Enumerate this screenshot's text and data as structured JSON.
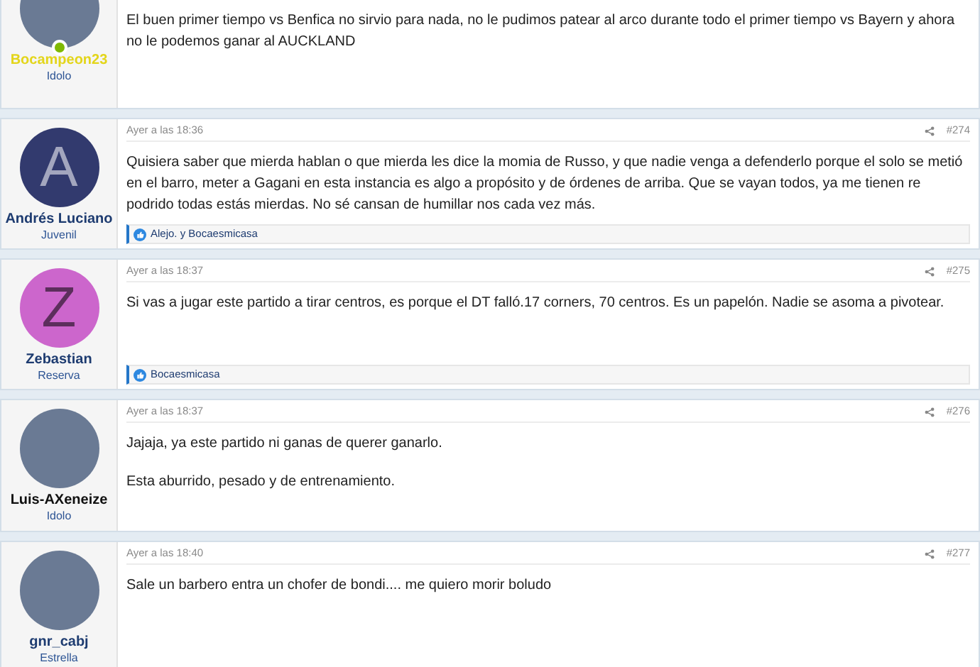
{
  "posts": [
    {
      "author": {
        "name": "Bocampeon23",
        "color": "#e3d51a",
        "rank": "Idolo",
        "avatar": {
          "kind": "photo"
        },
        "online": true
      },
      "paragraphs": [
        "El buen primer tiempo vs Benfica no sirvio para nada, no le pudimos patear al arco durante todo el primer tiempo vs Bayern y ahora no le podemos ganar al AUCKLAND"
      ]
    },
    {
      "author": {
        "name": "Andrés Luciano",
        "color": "#1d3b70",
        "rank": "Juvenil",
        "avatar": {
          "kind": "letter",
          "letter": "A",
          "color": "#323a6e"
        },
        "online": false
      },
      "date": "Ayer a las 18:36",
      "number": "#274",
      "paragraphs": [
        "Quisiera saber que mierda hablan o que mierda les dice la momia de Russo, y que nadie venga a defenderlo porque el solo se metió en el barro, meter a Gagani en esta instancia es algo a propósito y de órdenes de arriba. Que se vayan todos, ya me tienen re podrido todas estás mierdas. No sé cansan de humillar nos cada vez más."
      ],
      "reactions": "Alejo. y Bocaesmicasa"
    },
    {
      "author": {
        "name": "Zebastian",
        "color": "#1d3b70",
        "rank": "Reserva",
        "avatar": {
          "kind": "letter",
          "letter": "Z",
          "color": "#cc66cc"
        },
        "online": false
      },
      "date": "Ayer a las 18:37",
      "number": "#275",
      "paragraphs": [
        "Si vas a jugar este partido a tirar centros, es porque el DT falló.17 corners, 70 centros. Es un papelón. Nadie se asoma a pivotear."
      ],
      "reactions": "Bocaesmicasa"
    },
    {
      "author": {
        "name": "Luis-AXeneize",
        "color": "#111111",
        "rank": "Idolo",
        "avatar": {
          "kind": "photo"
        },
        "online": false
      },
      "date": "Ayer a las 18:37",
      "number": "#276",
      "paragraphs": [
        "Jajaja, ya este partido ni ganas de querer ganarlo.",
        "Esta aburrido, pesado y de entrenamiento."
      ]
    },
    {
      "author": {
        "name": "gnr_cabj",
        "color": "#1d3b70",
        "rank": "Estrella",
        "avatar": {
          "kind": "photo"
        },
        "online": false
      },
      "date": "Ayer a las 18:40",
      "number": "#277",
      "paragraphs": [
        "Sale un barbero entra un chofer de bondi.... me quiero morir boludo"
      ]
    }
  ]
}
